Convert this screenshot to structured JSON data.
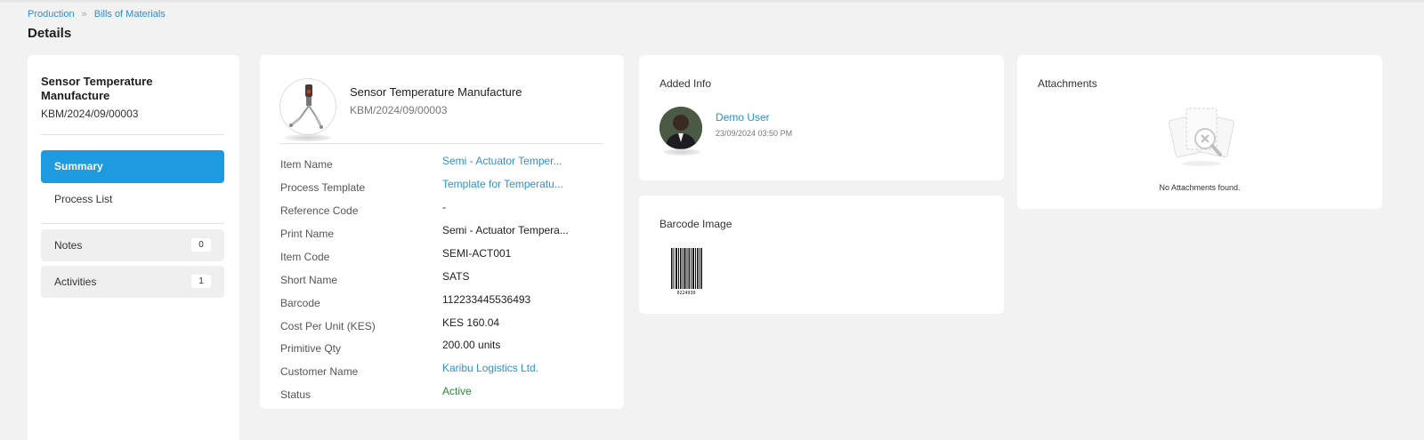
{
  "breadcrumb": {
    "parent": "Production",
    "current": "Bills of Materials"
  },
  "page_title": "Details",
  "left_panel": {
    "title": "Sensor Temperature Manufacture",
    "code": "KBM/2024/09/00003",
    "nav": {
      "summary": "Summary",
      "process_list": "Process List"
    },
    "notes": {
      "label": "Notes",
      "count": "0"
    },
    "activities": {
      "label": "Activities",
      "count": "1"
    }
  },
  "detail": {
    "title": "Sensor Temperature Manufacture",
    "code": "KBM/2024/09/00003",
    "fields": [
      {
        "label": "Item Name",
        "value": "Semi - Actuator Temper..."
      },
      {
        "label": "Process Template",
        "value": "Template for Temperatu..."
      },
      {
        "label": "Reference Code",
        "value": "-"
      },
      {
        "label": "Print Name",
        "value": "Semi - Actuator Tempera..."
      },
      {
        "label": "Item Code",
        "value": "SEMI-ACT001"
      },
      {
        "label": "Short Name",
        "value": "SATS"
      },
      {
        "label": "Barcode",
        "value": "112233445536493"
      },
      {
        "label": "Cost Per Unit (KES)",
        "value": "KES 160.04"
      },
      {
        "label": "Primitive Qty",
        "value": "200.00 units"
      },
      {
        "label": "Customer Name",
        "value": "Karibu Logistics Ltd."
      },
      {
        "label": "Status",
        "value": "Active"
      }
    ]
  },
  "added_info": {
    "heading": "Added Info",
    "user": "Demo User",
    "date": "23/09/2024 03:50 PM"
  },
  "barcode_card": {
    "heading": "Barcode Image",
    "caption": "0224930"
  },
  "attachments": {
    "heading": "Attachments",
    "empty_text": "No Attachments found."
  },
  "colors": {
    "accent": "#1e9be0",
    "link": "#2f8fd8",
    "active": "#2e8a3a",
    "background": "#f2f2f2"
  }
}
